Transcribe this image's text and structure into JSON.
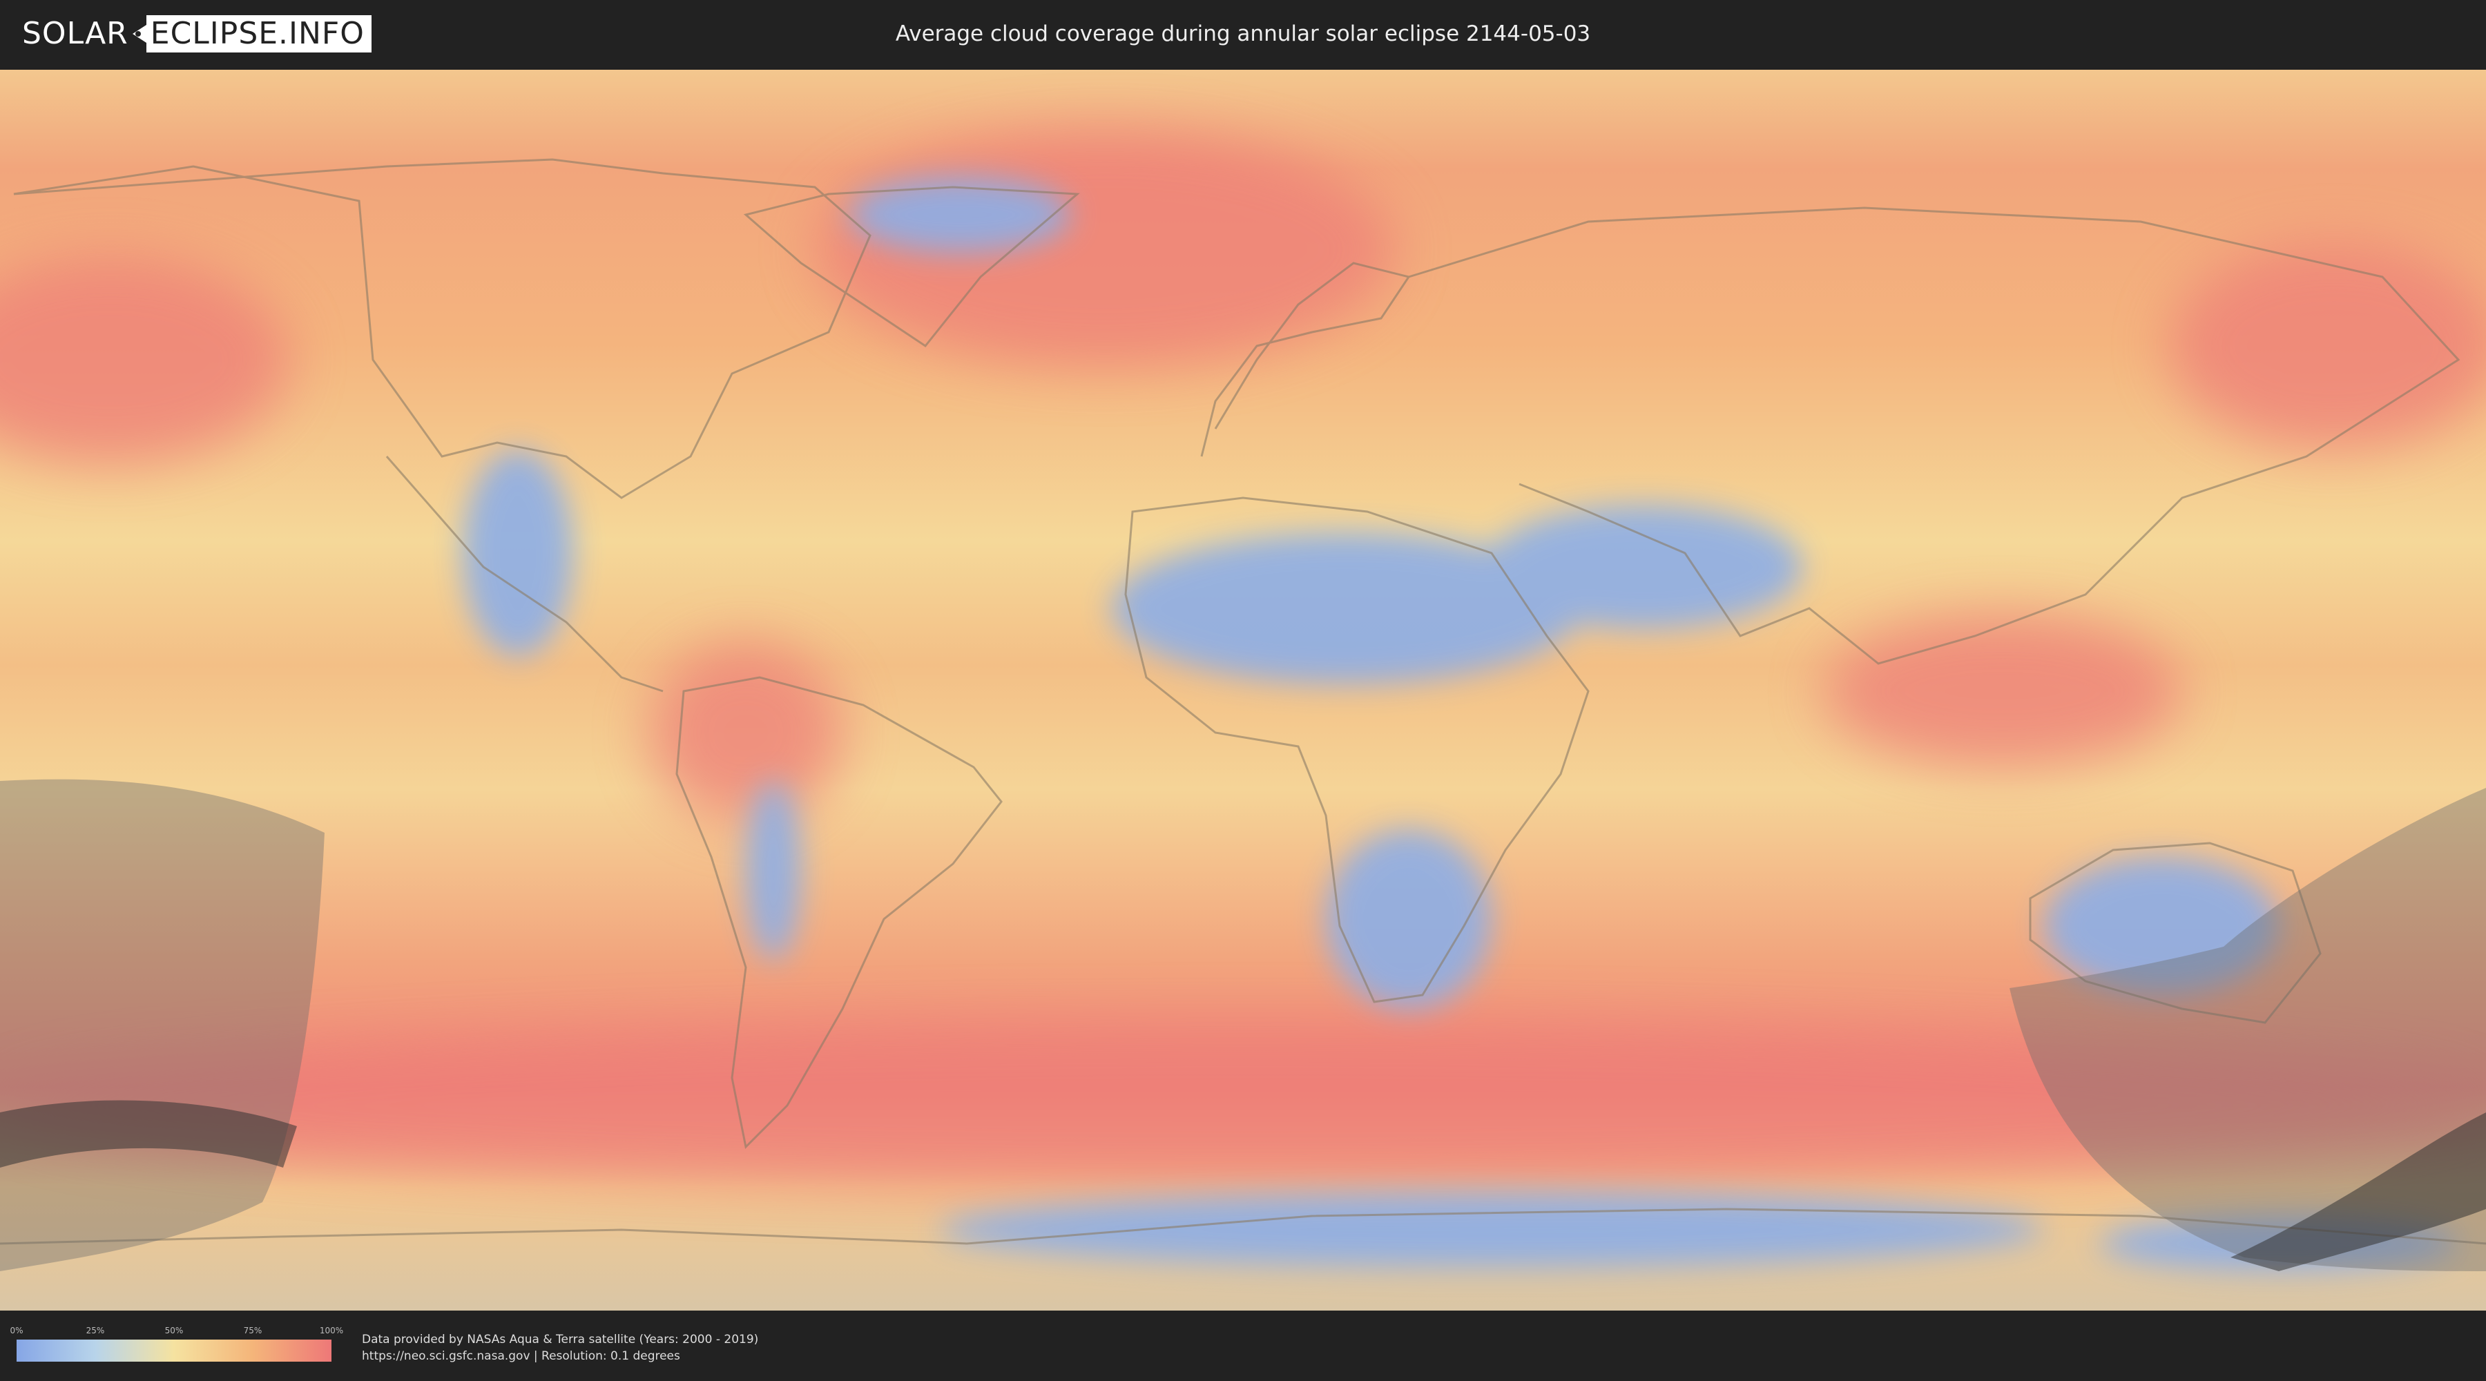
{
  "header": {
    "logo_left": "SOLAR",
    "logo_right": "ECLIPSE.INFO",
    "title": "Average cloud coverage during annular solar eclipse 2144-05-03"
  },
  "legend": {
    "ticks": [
      "0%",
      "25%",
      "50%",
      "75%",
      "100%"
    ],
    "colors": [
      "#86a6e6",
      "#b8d4ea",
      "#f5e2a0",
      "#f4b57a",
      "#ee7878"
    ]
  },
  "credits": {
    "line1": "Data provided by NASAs Aqua & Terra satellite (Years: 2000 - 2019)",
    "line2": "https://neo.sci.gsfc.nasa.gov | Resolution: 0.1 degrees"
  },
  "map": {
    "type": "world cloud coverage map",
    "colors": {
      "clear": "#86a6e6",
      "light": "#b8d4ea",
      "medium": "#f5e2a0",
      "heavy": "#f4b57a",
      "overcast": "#ee7878",
      "eclipse_shadow": "#555555"
    }
  }
}
